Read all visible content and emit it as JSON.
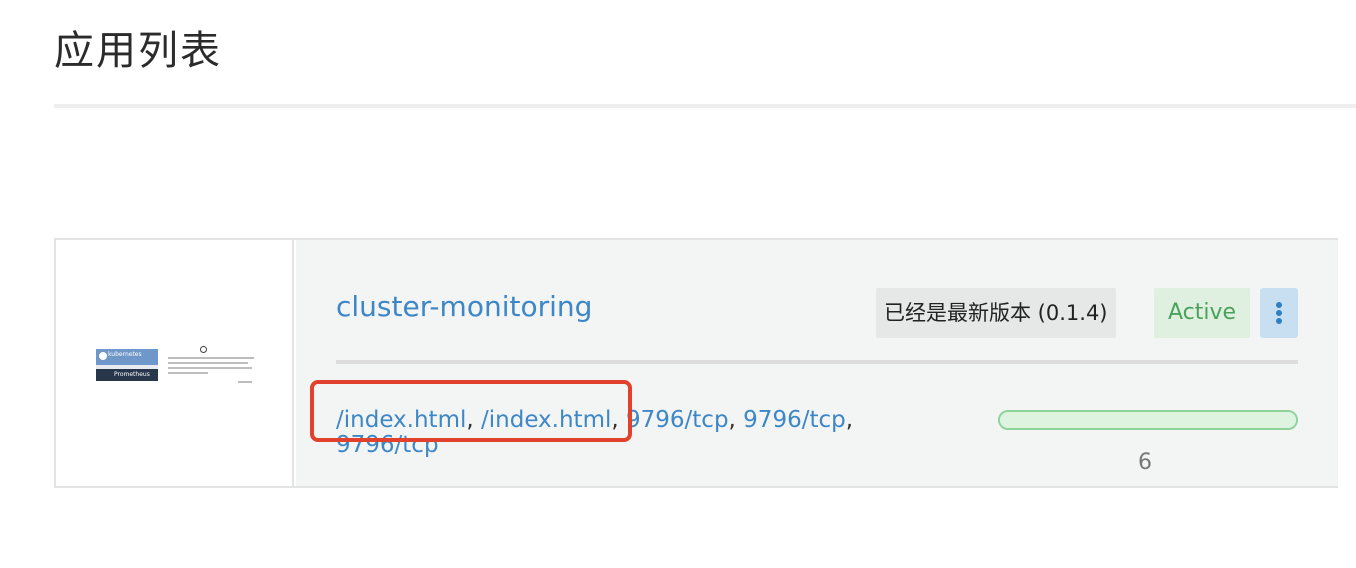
{
  "page": {
    "title": "应用列表"
  },
  "app": {
    "name": "cluster-monitoring",
    "version_text": "已经是最新版本 (0.1.4)",
    "status": "Active",
    "endpoints": [
      "/index.html",
      "/index.html",
      "9796/tcp",
      "9796/tcp",
      "9796/tcp"
    ],
    "separators": [
      ", ",
      ", ",
      ", ",
      ", "
    ],
    "progress": {
      "count": "6",
      "fraction": 1.0
    },
    "thumbnail": {
      "top_label": "kubernetes",
      "bottom_label": "Prometheus"
    },
    "menu_icon": "kebab-menu-icon"
  },
  "colors": {
    "link": "#3d87c7",
    "status_active": "#4aa25a",
    "highlight": "#e2412d",
    "progress_border": "#8ed49a"
  }
}
